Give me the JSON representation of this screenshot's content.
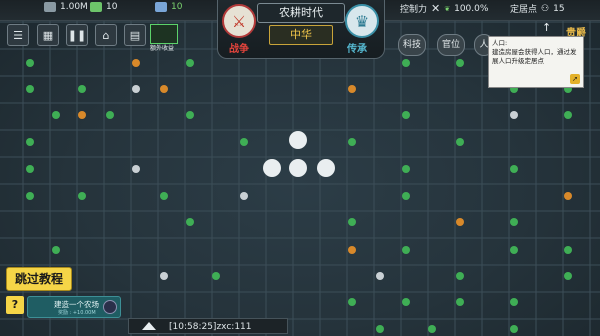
{
  "topbar": {
    "gold": "1.00M",
    "pop_value": "10",
    "green_value": "10",
    "control_label": "控制力",
    "control_value": "100.0%",
    "settle_label": "定居点",
    "settle_count": "15"
  },
  "center": {
    "era": "农耕时代",
    "civ": "中华",
    "war": "战争",
    "heritage": "传承"
  },
  "tabs": {
    "tech": "科技",
    "office": "官位",
    "people": "人"
  },
  "corner_label": "贵爵",
  "tooltip": {
    "title": "人口:",
    "body": "建造房屋会获得人口，通过发展人口升级定居点"
  },
  "badge_label": "额外收益",
  "skip": "跳过教程",
  "help": "?",
  "task": {
    "text": "建造一个农场",
    "sub": "奖励 : +10.00M"
  },
  "chat": "[10:58:25]zxc:111",
  "colors": {
    "gold": "#f5d547",
    "teal": "#1f5d63",
    "grid": "#3c4e58"
  }
}
